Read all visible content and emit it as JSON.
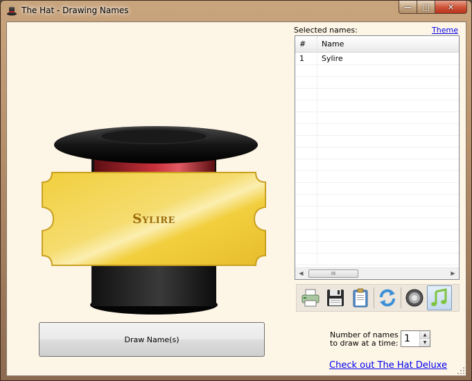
{
  "window": {
    "title": "The Hat - Drawing Names",
    "min_glyph": "—",
    "max_glyph": "□",
    "close_glyph": "✕"
  },
  "hat": {
    "ticket_name": "Sylire"
  },
  "draw_button": {
    "label": "Draw Name(s)"
  },
  "selected": {
    "label": "Selected names:",
    "theme_link": "Theme",
    "columns": [
      "#",
      "Name"
    ],
    "rows": [
      {
        "num": "1",
        "name": "Sylire"
      }
    ],
    "scroll_thumb_glyph": "III"
  },
  "toolbar": {
    "buttons": [
      {
        "icon": "printer-icon"
      },
      {
        "icon": "floppy-save-icon"
      },
      {
        "icon": "clipboard-icon"
      },
      {
        "icon": "refresh-icon"
      },
      {
        "icon": "speaker-icon"
      },
      {
        "icon": "music-note-icon",
        "active": true
      }
    ]
  },
  "draw_count": {
    "label_line1": "Number of names",
    "label_line2": "to draw at a time:",
    "value": "1"
  },
  "deluxe_link": "Check out The Hat Deluxe",
  "colors": {
    "ticket_gold": "#f2cf3e",
    "hat_band": "#b3202a",
    "client_bg": "#fdf5e6",
    "link": "#0000ee"
  }
}
